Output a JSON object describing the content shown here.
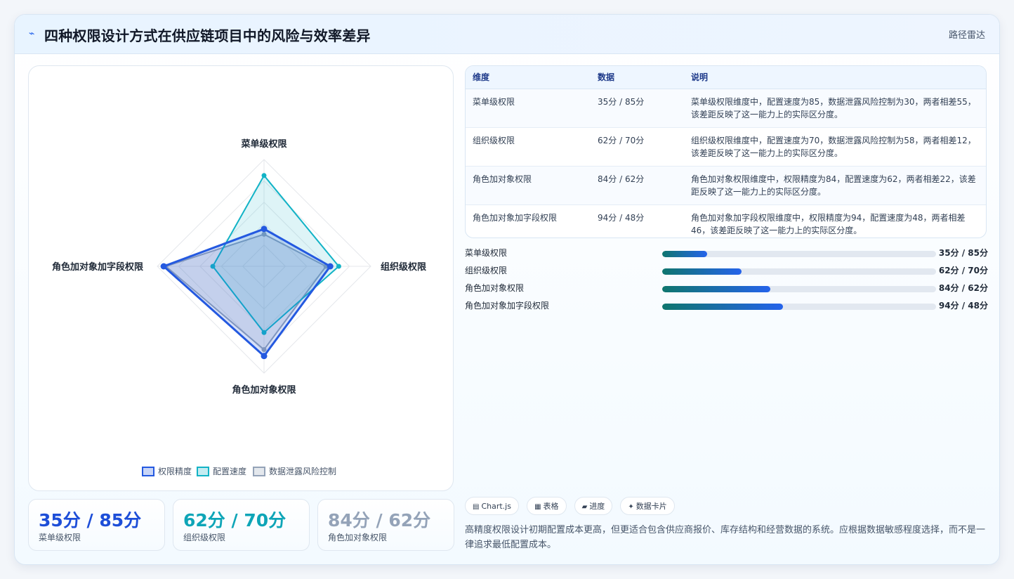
{
  "header": {
    "icon": "signal-icon",
    "title": "四种权限设计方式在供应链项目中的风险与效率差异",
    "tag": "路径雷达"
  },
  "chart_data": {
    "type": "radar",
    "axes": [
      "菜单级权限",
      "组织级权限",
      "角色加对象权限",
      "角色加对象加字段权限"
    ],
    "rmax": 100,
    "series": [
      {
        "name": "权限精度",
        "values": [
          35,
          62,
          84,
          94
        ],
        "color": "#2459e0"
      },
      {
        "name": "配置速度",
        "values": [
          85,
          70,
          62,
          48
        ],
        "color": "#12b3c6"
      },
      {
        "name": "数据泄露风险控制",
        "values": [
          30,
          58,
          78,
          92
        ],
        "color": "#94a3b8"
      }
    ],
    "legend_position": "bottom"
  },
  "stats": [
    {
      "value": "35分 / 85分",
      "label": "菜单级权限",
      "color": "#1d4ed8"
    },
    {
      "value": "62分 / 70分",
      "label": "组织级权限",
      "color": "#0ea5b7"
    },
    {
      "value": "84分 / 62分",
      "label": "角色加对象权限",
      "color": "#94a3b8"
    }
  ],
  "table": {
    "headers": [
      "维度",
      "数据",
      "说明"
    ],
    "rows": [
      {
        "dimension": "菜单级权限",
        "data": "35分 / 85分",
        "desc": "菜单级权限维度中，配置速度为85，数据泄露风险控制为30，两者相差55，该差距反映了这一能力上的实际区分度。"
      },
      {
        "dimension": "组织级权限",
        "data": "62分 / 70分",
        "desc": "组织级权限维度中，配置速度为70，数据泄露风险控制为58，两者相差12，该差距反映了这一能力上的实际区分度。"
      },
      {
        "dimension": "角色加对象权限",
        "data": "84分 / 62分",
        "desc": "角色加对象权限维度中，权限精度为84，配置速度为62，两者相差22，该差距反映了这一能力上的实际区分度。"
      },
      {
        "dimension": "角色加对象加字段权限",
        "data": "94分 / 48分",
        "desc": "角色加对象加字段权限维度中，权限精度为94，配置速度为48，两者相差46，该差距反映了这一能力上的实际区分度。"
      }
    ]
  },
  "progress": [
    {
      "label": "菜单级权限",
      "value": "35分 / 85分",
      "fill_fraction": 0.165
    },
    {
      "label": "组织级权限",
      "value": "62分 / 70分",
      "fill_fraction": 0.29
    },
    {
      "label": "角色加对象权限",
      "value": "84分 / 62分",
      "fill_fraction": 0.395
    },
    {
      "label": "角色加对象加字段权限",
      "value": "94分 / 48分",
      "fill_fraction": 0.44
    }
  ],
  "chips": [
    {
      "icon": "chart-icon",
      "glyph": "▤",
      "label": "Chart.js"
    },
    {
      "icon": "table-icon",
      "glyph": "▦",
      "label": "表格"
    },
    {
      "icon": "progress-icon",
      "glyph": "▰",
      "label": "进度"
    },
    {
      "icon": "sparkle-icon",
      "glyph": "✦",
      "label": "数据卡片"
    }
  ],
  "note": "高精度权限设计初期配置成本更高，但更适合包含供应商报价、库存结构和经营数据的系统。应根据数据敏感程度选择，而不是一律追求最低配置成本。"
}
